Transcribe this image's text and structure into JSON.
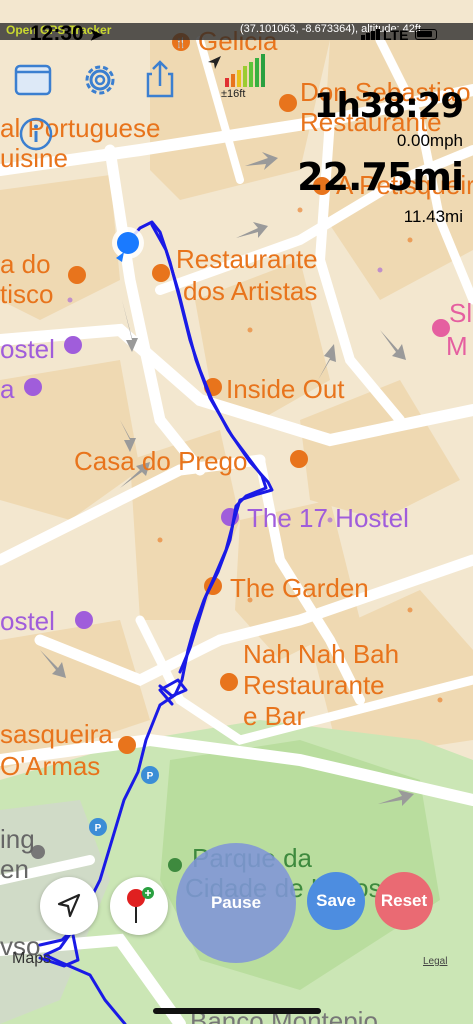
{
  "status": {
    "app_tag": "Open GPS Tracker",
    "time": "12:30",
    "coordinates": "(37.101063, -8.673364), altitude: 42ft",
    "network": "LTE"
  },
  "toolbar": {
    "folder_icon": "folder-icon",
    "settings_icon": "gear-icon",
    "share_icon": "share-icon",
    "info_icon": "info-icon"
  },
  "gps": {
    "accuracy": "±16ft"
  },
  "stats": {
    "duration": "1h38:29",
    "speed": "0.00mph",
    "distance": "22.75mi",
    "secondary_distance": "11.43mi"
  },
  "map": {
    "labels": [
      {
        "text": "Gelicia",
        "kind": "poi"
      },
      {
        "text": "Don Sebastiao",
        "kind": "poi"
      },
      {
        "text": "Restaurante",
        "kind": "poi"
      },
      {
        "text": "A Petisqueira",
        "kind": "poi"
      },
      {
        "text": "al Portuguese",
        "kind": "poi"
      },
      {
        "text": "uisine",
        "kind": "poi"
      },
      {
        "text": "a do",
        "kind": "poi"
      },
      {
        "text": "tisco",
        "kind": "poi"
      },
      {
        "text": "Restaurante",
        "kind": "poi"
      },
      {
        "text": "dos Artistas",
        "kind": "poi"
      },
      {
        "text": "Sl",
        "kind": "hotel-pink"
      },
      {
        "text": "M",
        "kind": "hotel-pink"
      },
      {
        "text": "ostel",
        "kind": "hotel"
      },
      {
        "text": "a",
        "kind": "hotel"
      },
      {
        "text": "Inside Out",
        "kind": "poi"
      },
      {
        "text": "Casa do Prego",
        "kind": "poi"
      },
      {
        "text": "The 17 Hostel",
        "kind": "hotel"
      },
      {
        "text": "The Garden",
        "kind": "poi"
      },
      {
        "text": "ostel",
        "kind": "hotel"
      },
      {
        "text": "Nah Nah Bah",
        "kind": "poi"
      },
      {
        "text": "Restaurante",
        "kind": "poi"
      },
      {
        "text": "e Bar",
        "kind": "poi"
      },
      {
        "text": "sasqueira",
        "kind": "poi"
      },
      {
        "text": "O'Armas",
        "kind": "poi"
      },
      {
        "text": "Parque da",
        "kind": "park"
      },
      {
        "text": "Cidade de Lagos",
        "kind": "park"
      },
      {
        "text": "ing",
        "kind": "gray"
      },
      {
        "text": "en",
        "kind": "gray"
      },
      {
        "text": "vso",
        "kind": "gray"
      },
      {
        "text": "Banco Montepio",
        "kind": "gray"
      }
    ],
    "colors": {
      "poi": "#e8741c",
      "hotel": "#a05ddb",
      "park_text": "#3e8a3e",
      "route": "#1a1ae6",
      "land": "#f3e7cf"
    }
  },
  "controls": {
    "pause": "Pause",
    "save": "Save",
    "reset": "Reset",
    "navigate_icon": "location-arrow-icon",
    "pin_icon": "add-pin-icon"
  },
  "footer": {
    "maps": "Maps",
    "legal": "Legal"
  }
}
